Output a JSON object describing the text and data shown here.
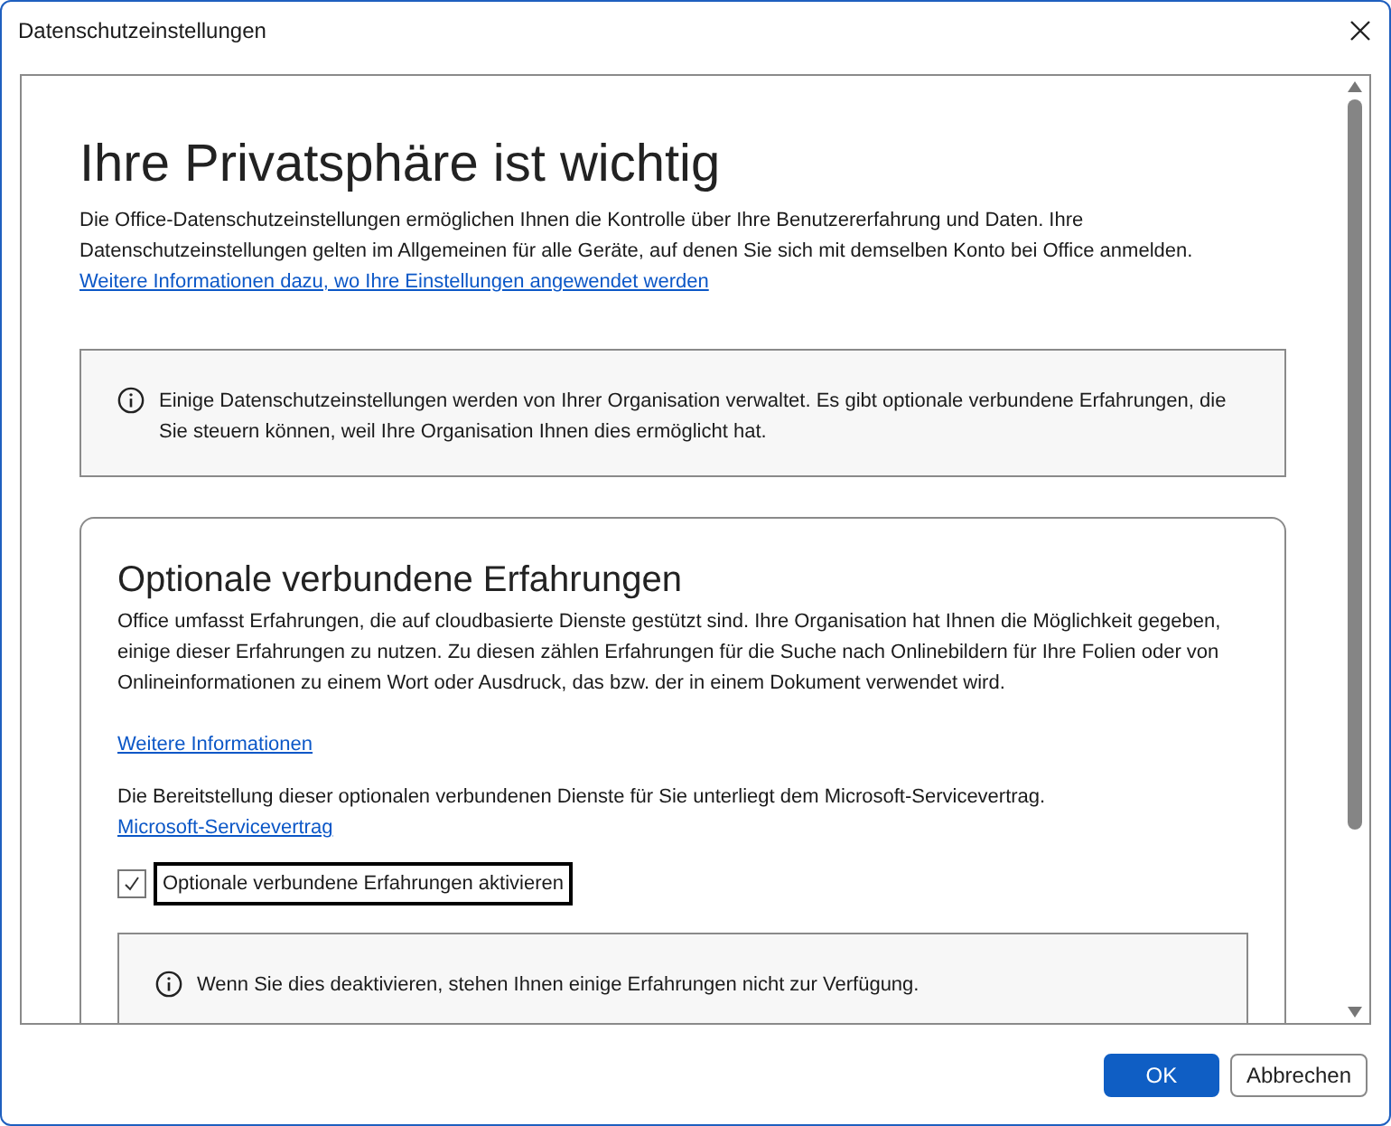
{
  "window": {
    "title": "Datenschutzeinstellungen"
  },
  "heading": "Ihre Privatsphäre ist wichtig",
  "intro": "Die Office-Datenschutzeinstellungen ermöglichen Ihnen die Kontrolle über Ihre Benutzererfahrung und Daten. Ihre Datenschutzeinstellungen gelten im Allgemeinen für alle Geräte, auf denen Sie sich mit demselben Konto bei Office anmelden.",
  "intro_link": "Weitere Informationen dazu, wo Ihre Einstellungen angewendet werden",
  "org_notice": "Einige Datenschutzeinstellungen werden von Ihrer Organisation verwaltet. Es gibt optionale verbundene Erfahrungen, die Sie steuern können, weil Ihre Organisation Ihnen dies ermöglicht hat.",
  "optional_section": {
    "title": "Optionale verbundene Erfahrungen",
    "description": "Office umfasst Erfahrungen, die auf cloudbasierte Dienste gestützt sind. Ihre Organisation hat Ihnen die Möglichkeit gegeben, einige dieser Erfahrungen zu nutzen. Zu diesen zählen Erfahrungen für die Suche nach Onlinebildern für Ihre Folien oder von Onlineinformationen zu einem Wort oder Ausdruck, das bzw. der in einem Dokument verwendet wird.",
    "more_info_link": "Weitere Informationen",
    "service_text": "Die Bereitstellung dieser optionalen verbundenen Dienste für Sie unterliegt dem Microsoft-Servicevertrag.",
    "service_link": "Microsoft-Servicevertrag",
    "checkbox": {
      "label": "Optionale verbundene Erfahrungen aktivieren",
      "checked": true,
      "focused": true
    },
    "notice": "Wenn Sie dies deaktivieren, stehen Ihnen einige Erfahrungen nicht zur Verfügung."
  },
  "buttons": [
    {
      "label": "OK",
      "kind": "primary"
    },
    {
      "label": "Abbrechen",
      "kind": "secondary"
    }
  ]
}
